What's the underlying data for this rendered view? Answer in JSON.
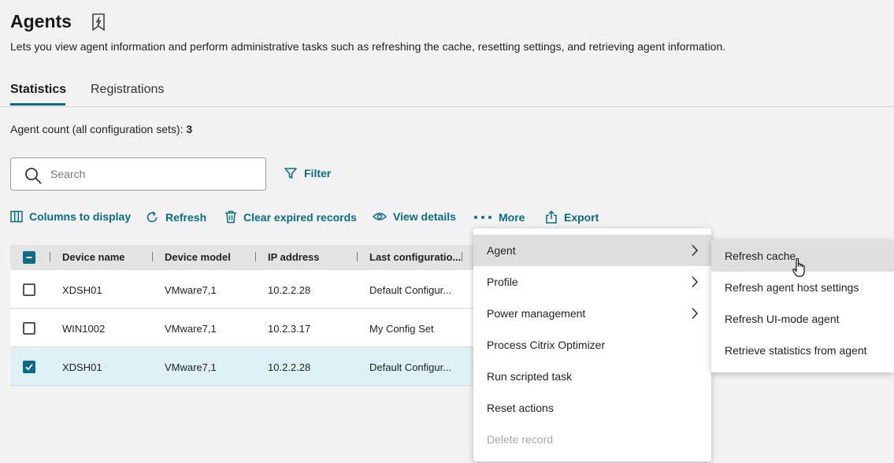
{
  "header": {
    "title": "Agents",
    "description": "Lets you view agent information and perform administrative tasks such as refreshing the cache, resetting settings, and retrieving agent information."
  },
  "tabs": [
    {
      "label": "Statistics",
      "active": true
    },
    {
      "label": "Registrations",
      "active": false
    }
  ],
  "agent_count": {
    "label": "Agent count (all configuration sets): ",
    "value": "3"
  },
  "search": {
    "placeholder": "Search",
    "value": ""
  },
  "filter_label": "Filter",
  "toolbar": {
    "columns": "Columns to display",
    "refresh": "Refresh",
    "clear": "Clear expired records",
    "view": "View details",
    "more": "More",
    "export": "Export"
  },
  "table": {
    "columns": [
      "Device name",
      "Device model",
      "IP address",
      "Last configuratio..."
    ],
    "rows": [
      {
        "name": "XDSH01",
        "model": "VMware7,1",
        "ip": "10.2.2.28",
        "config": "Default Configur...",
        "checked": false
      },
      {
        "name": "WIN1002",
        "model": "VMware7,1",
        "ip": "10.2.3.17",
        "config": "My Config Set",
        "checked": false
      },
      {
        "name": "XDSH01",
        "model": "VMware7,1",
        "ip": "10.2.2.28",
        "config": "Default Configur...",
        "checked": true
      }
    ]
  },
  "more_menu": {
    "items": [
      {
        "label": "Agent",
        "submenu": true,
        "highlighted": true
      },
      {
        "label": "Profile",
        "submenu": true
      },
      {
        "label": "Power management",
        "submenu": true
      },
      {
        "label": "Process Citrix Optimizer"
      },
      {
        "label": "Run scripted task"
      },
      {
        "label": "Reset actions"
      },
      {
        "label": "Delete record",
        "disabled": true
      }
    ]
  },
  "agent_submenu": {
    "items": [
      {
        "label": "Refresh cache",
        "highlighted": true
      },
      {
        "label": "Refresh agent host settings"
      },
      {
        "label": "Refresh UI-mode agent"
      },
      {
        "label": "Retrieve statistics from agent"
      }
    ]
  },
  "colors": {
    "accent": "#0a6c85",
    "selected_row": "#def2f5"
  }
}
